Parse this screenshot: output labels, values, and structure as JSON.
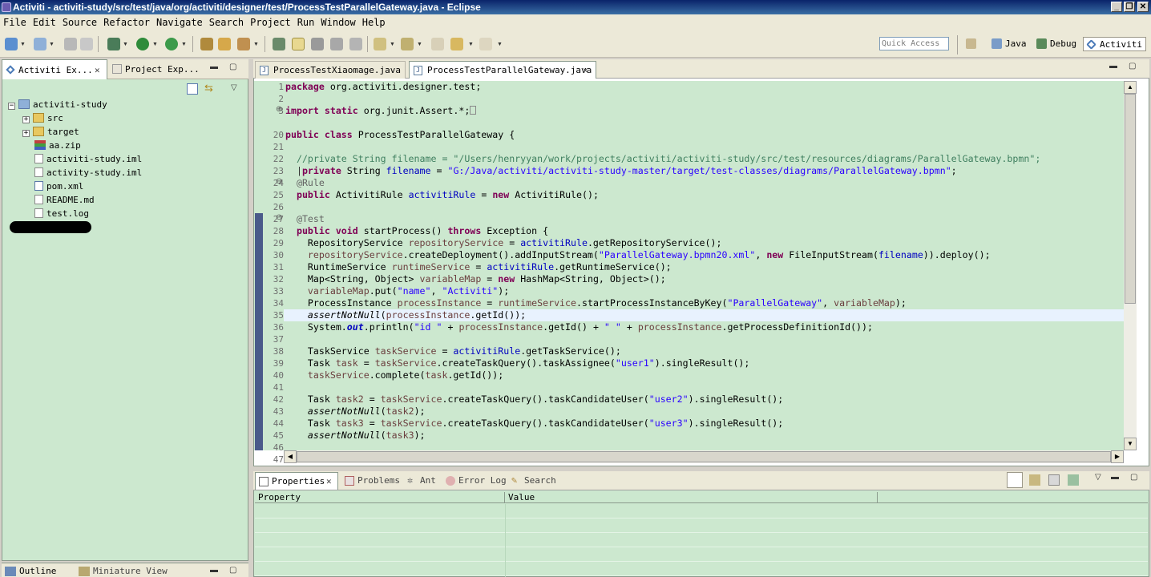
{
  "window": {
    "title": "Activiti - activiti-study/src/test/java/org/activiti/designer/test/ProcessTestParallelGateway.java - Eclipse",
    "minimize": "_",
    "restore": "❐",
    "close": "✕"
  },
  "menu": [
    "File",
    "Edit",
    "Source",
    "Refactor",
    "Navigate",
    "Search",
    "Project",
    "Run",
    "Window",
    "Help"
  ],
  "toolbar": {
    "quick_access_placeholder": "Quick Access",
    "perspectives": [
      "Java",
      "Debug",
      "Activiti"
    ],
    "icons": {
      "accent": "#3a6ea5"
    }
  },
  "left": {
    "tabs": [
      "Activiti Ex...",
      "Project Exp..."
    ],
    "tree": {
      "root": "activiti-study",
      "items": [
        "src",
        "target",
        "aa.zip",
        "activiti-study.iml",
        "activity-study.iml",
        "pom.xml",
        "README.md",
        "test.log"
      ]
    },
    "bottom_tabs": [
      "Outline",
      "Miniature View"
    ]
  },
  "editor": {
    "tabs": [
      "ProcessTestXiaomage.java",
      "ProcessTestParallelGateway.java"
    ],
    "line_numbers": [
      "1",
      "2",
      "3",
      "20",
      "21",
      "22",
      "23",
      "24",
      "25",
      "26",
      "27",
      "28",
      "29",
      "30",
      "31",
      "32",
      "33",
      "34",
      "35",
      "36",
      "37",
      "38",
      "39",
      "40",
      "41",
      "42",
      "43",
      "44",
      "45",
      "46",
      "47"
    ],
    "code": {
      "l1a": "package",
      "l1b": " org.activiti.designer.test;",
      "l3a": "import static",
      "l3b": " org.junit.Assert.*;",
      "l20a": "public class",
      "l20b": " ProcessTestParallelGateway {",
      "l23": "  //private String filename = \"/Users/henryyan/work/projects/activiti/activiti-study/src/test/resources/diagrams/ParallelGateway.bpmn\";",
      "l24a": "private",
      "l24b": " String ",
      "l24c": "filename",
      "l24d": " = ",
      "l24e": "\"G:/Java/activiti/activiti-study-master/target/test-classes/diagrams/ParallelGateway.bpmn\"",
      "l24f": ";",
      "l25": "@Rule",
      "l26a": "public",
      "l26b": " ActivitiRule ",
      "l26c": "activitiRule",
      "l26d": " = ",
      "l26e": "new",
      "l26f": " ActivitiRule();",
      "l28": "@Test",
      "l29a": "public void",
      "l29b": " startProcess() ",
      "l29c": "throws",
      "l29d": " Exception {",
      "l30a": "RepositoryService ",
      "l30b": "repositoryService",
      "l30c": " = ",
      "l30d": "activitiRule",
      "l30e": ".getRepositoryService();",
      "l31a": "repositoryService",
      "l31b": ".createDeployment().addInputStream(",
      "l31c": "\"ParallelGateway.bpmn20.xml\"",
      "l31d": ", ",
      "l31e": "new",
      "l31f": " FileInputStream(",
      "l31g": "filename",
      "l31h": ")).deploy();",
      "l32a": "RuntimeService ",
      "l32b": "runtimeService",
      "l32c": " = ",
      "l32d": "activitiRule",
      "l32e": ".getRuntimeService();",
      "l33a": "Map<String, Object> ",
      "l33b": "variableMap",
      "l33c": " = ",
      "l33d": "new",
      "l33e": " HashMap<String, Object>();",
      "l34a": "variableMap",
      "l34b": ".put(",
      "l34c": "\"name\"",
      "l34d": ", ",
      "l34e": "\"Activiti\"",
      "l34f": ");",
      "l35a": "ProcessInstance ",
      "l35b": "processInstance",
      "l35c": " = ",
      "l35d": "runtimeService",
      "l35e": ".startProcessInstanceByKey(",
      "l35f": "\"ParallelGateway\"",
      "l35g": ", ",
      "l35h": "variableMap",
      "l35i": ");",
      "l36a": "assertNotNull",
      "l36b": "(",
      "l36c": "processInstance",
      "l36d": ".getId());",
      "l37a": "System.",
      "l37b": "out",
      "l37c": ".println(",
      "l37d": "\"id \"",
      "l37e": " + ",
      "l37f": "processInstance",
      "l37g": ".getId() + ",
      "l37h": "\" \"",
      "l37i": " + ",
      "l37j": "processInstance",
      "l37k": ".getProcessDefinitionId());",
      "l39a": "TaskService ",
      "l39b": "taskService",
      "l39c": " = ",
      "l39d": "activitiRule",
      "l39e": ".getTaskService();",
      "l40a": "Task ",
      "l40b": "task",
      "l40c": " = ",
      "l40d": "taskService",
      "l40e": ".createTaskQuery().taskAssignee(",
      "l40f": "\"user1\"",
      "l40g": ").singleResult();",
      "l41a": "taskService",
      "l41b": ".complete(",
      "l41c": "task",
      "l41d": ".getId());",
      "l43a": "Task ",
      "l43b": "task2",
      "l43c": " = ",
      "l43d": "taskService",
      "l43e": ".createTaskQuery().taskCandidateUser(",
      "l43f": "\"user2\"",
      "l43g": ").singleResult();",
      "l44a": "assertNotNull",
      "l44b": "(",
      "l44c": "task2",
      "l44d": ");",
      "l45a": "Task ",
      "l45b": "task3",
      "l45c": " = ",
      "l45d": "taskService",
      "l45e": ".createTaskQuery().taskCandidateUser(",
      "l45f": "\"user3\"",
      "l45g": ").singleResult();",
      "l46a": "assertNotNull",
      "l46b": "(",
      "l46c": "task3",
      "l46d": ");"
    }
  },
  "bottom": {
    "tabs": [
      "Properties",
      "Problems",
      "Ant",
      "Error Log",
      "Search"
    ],
    "columns": [
      "Property",
      "Value"
    ]
  }
}
